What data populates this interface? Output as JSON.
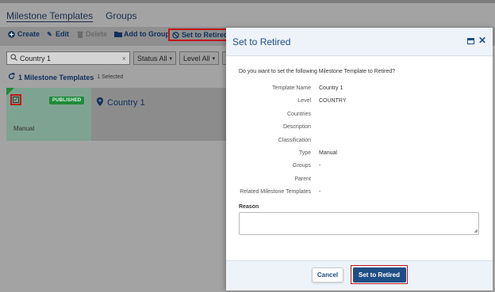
{
  "page_tabs": [
    {
      "label": "Milestone Templates",
      "active": true
    },
    {
      "label": "Groups",
      "active": false
    }
  ],
  "toolbar": {
    "create": "Create",
    "edit": "Edit",
    "delete": "Delete",
    "add_to_group": "Add to Group",
    "set_to_retired": "Set to Retired"
  },
  "filters": {
    "search_value": "Country 1",
    "status": "Status All",
    "level": "Level All",
    "more": "C"
  },
  "list": {
    "count_label": "1 Milestone Templates",
    "selected_label": "1 Selected"
  },
  "card": {
    "status_badge": "PUBLISHED",
    "title": "Country 1",
    "type": "Manual"
  },
  "modal": {
    "title": "Set to Retired",
    "question": "Do you want to set the following Milestone Template to Retired?",
    "fields": [
      {
        "label": "Template Name",
        "value": "Country 1"
      },
      {
        "label": "Level",
        "value": "COUNTRY"
      },
      {
        "label": "Countries",
        "value": ""
      },
      {
        "label": "Description",
        "value": ""
      },
      {
        "label": "Classification",
        "value": ""
      },
      {
        "label": "Type",
        "value": "Manual"
      },
      {
        "label": "Groups",
        "value": "-"
      },
      {
        "label": "Parent",
        "value": ""
      },
      {
        "label": "Related Milestone Templates",
        "value": "-"
      }
    ],
    "reason_label": "Reason",
    "cancel_label": "Cancel",
    "confirm_label": "Set to Retired"
  },
  "colors": {
    "accent": "#1f4e85",
    "highlight_border": "#c0161c",
    "published": "#1f8a3a"
  }
}
